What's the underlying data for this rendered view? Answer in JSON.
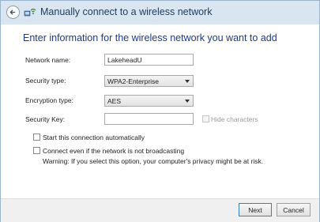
{
  "window": {
    "title": "Manually connect to a wireless network",
    "heading": "Enter information for the wireless network you want to add"
  },
  "form": {
    "network_name_label": "Network name:",
    "network_name_value": "LakeheadU",
    "security_type_label": "Security type:",
    "security_type_value": "WPA2-Enterprise",
    "encryption_type_label": "Encryption type:",
    "encryption_type_value": "AES",
    "security_key_label": "Security Key:",
    "security_key_value": "",
    "hide_characters_label": "Hide characters"
  },
  "options": {
    "start_auto_label": "Start this connection automatically",
    "connect_even_label": "Connect even if the network is not broadcasting",
    "warning_text": "Warning: If you select this option, your computer's privacy might be at risk."
  },
  "buttons": {
    "next_label": "Next",
    "cancel_label": "Cancel"
  },
  "icons": {
    "back": "back-arrow-icon",
    "network": "wireless-network-icon"
  },
  "colors": {
    "titlebar_bg": "#d9e6f2",
    "heading_text": "#1e3a8a",
    "default_button_border": "#3c7fb1"
  }
}
